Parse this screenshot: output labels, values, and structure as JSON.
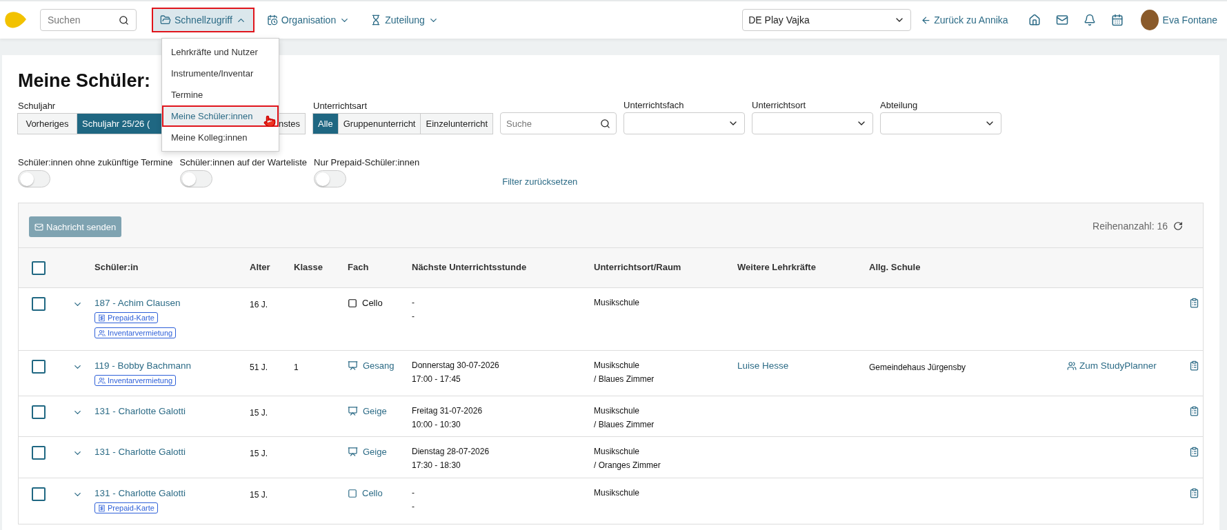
{
  "topbar": {
    "search": {
      "placeholder": "Suchen"
    },
    "nav": [
      {
        "label": "Schnellzugriff",
        "kind": "folder",
        "expanded": true,
        "highlighted": true
      },
      {
        "label": "Organisation",
        "kind": "calendar",
        "expanded": false,
        "highlighted": false
      },
      {
        "label": "Zuteilung",
        "kind": "hourglass",
        "expanded": false,
        "highlighted": false
      }
    ],
    "menu": [
      {
        "label": "Lehrkräfte und Nutzer",
        "selected": false,
        "highlighted": false
      },
      {
        "label": "Instrumente/Inventar",
        "selected": false,
        "highlighted": false
      },
      {
        "label": "Termine",
        "selected": false,
        "highlighted": false
      },
      {
        "label": "Meine Schüler:innen",
        "selected": true,
        "highlighted": true
      },
      {
        "label": "Meine Kolleg:innen",
        "selected": false,
        "highlighted": false
      }
    ],
    "school_select": "DE Play Vajka",
    "back_link": "Zurück zu Annika",
    "user": "Eva Fontane"
  },
  "title": "Meine Schüler:",
  "filters": {
    "year": {
      "label": "Schuljahr",
      "options": [
        {
          "label": "Vorheriges",
          "selected": false
        },
        {
          "label": "Schuljahr 25/26 (",
          "selected": true
        },
        {
          "label": "nstes",
          "selected": false
        }
      ]
    },
    "type": {
      "label": "Unterrichtsart",
      "options": [
        {
          "label": "Alle",
          "selected": true
        },
        {
          "label": "Gruppenunterricht",
          "selected": false
        },
        {
          "label": "Einzelunterricht",
          "selected": false
        }
      ]
    },
    "search": {
      "placeholder": "Suche"
    },
    "selects": [
      "Unterrichtsfach",
      "Unterrichtsort",
      "Abteilung"
    ],
    "toggles": [
      {
        "label": "Schüler:innen ohne zukünftige Termine",
        "on": false
      },
      {
        "label": "Schüler:innen auf der Warteliste",
        "on": false
      },
      {
        "label": "Nur Prepaid-Schüler:innen",
        "on": false
      }
    ],
    "reset": "Filter zurücksetzen"
  },
  "table": {
    "select_all": {
      "checked": false
    },
    "send_button": "Nachricht senden",
    "row_count": "Reihenanzahl: 16",
    "columns": [
      "Schüler:in",
      "Alter",
      "Klasse",
      "Fach",
      "Nächste Unterrichtsstunde",
      "Unterrichtsort/Raum",
      "Weitere Lehrkräfte",
      "Allg. Schule"
    ],
    "rows": [
      {
        "checked": false,
        "student": "187 - Achim Clausen",
        "badges": [
          {
            "kind": "prepaid",
            "label": "Prepaid-Karte"
          },
          {
            "kind": "inventory",
            "label": "Inventarvermietung"
          }
        ],
        "age": "16 J.",
        "class": "",
        "subject": {
          "kind": "group",
          "label": "Cello",
          "linked": false
        },
        "next": [
          "-",
          "-"
        ],
        "place": [
          "Musikschule"
        ],
        "teacher": "",
        "school": "",
        "planner": ""
      },
      {
        "checked": false,
        "student": "119 - Bobby Bachmann",
        "badges": [
          {
            "kind": "inventory",
            "label": "Inventarvermietung"
          }
        ],
        "age": "51 J.",
        "class": "1",
        "subject": {
          "kind": "single",
          "label": "Gesang",
          "linked": true
        },
        "next": [
          "Donnerstag 30-07-2026",
          "17:00 - 17:45"
        ],
        "place": [
          "Musikschule",
          "/ Blaues Zimmer"
        ],
        "teacher": "Luise Hesse",
        "school": "Gemeindehaus Jürgensby",
        "planner": "Zum StudyPlanner"
      },
      {
        "checked": false,
        "student": "131 - Charlotte Galotti",
        "badges": [],
        "age": "15 J.",
        "class": "",
        "subject": {
          "kind": "single",
          "label": "Geige",
          "linked": true
        },
        "next": [
          "Freitag 31-07-2026",
          "10:00 - 10:30"
        ],
        "place": [
          "Musikschule",
          "/ Blaues Zimmer"
        ],
        "teacher": "",
        "school": "",
        "planner": ""
      },
      {
        "checked": false,
        "student": "131 - Charlotte Galotti",
        "badges": [],
        "age": "15 J.",
        "class": "",
        "subject": {
          "kind": "single",
          "label": "Geige",
          "linked": true
        },
        "next": [
          "Dienstag 28-07-2026",
          "17:30 - 18:30"
        ],
        "place": [
          "Musikschule",
          "/ Oranges Zimmer"
        ],
        "teacher": "",
        "school": "",
        "planner": ""
      },
      {
        "checked": false,
        "student": "131 - Charlotte Galotti",
        "badges": [
          {
            "kind": "prepaid",
            "label": "Prepaid-Karte"
          }
        ],
        "age": "15 J.",
        "class": "",
        "subject": {
          "kind": "group",
          "label": "Cello",
          "linked": true
        },
        "next": [
          "-",
          "-"
        ],
        "place": [
          "Musikschule"
        ],
        "teacher": "",
        "school": "",
        "planner": ""
      }
    ]
  }
}
